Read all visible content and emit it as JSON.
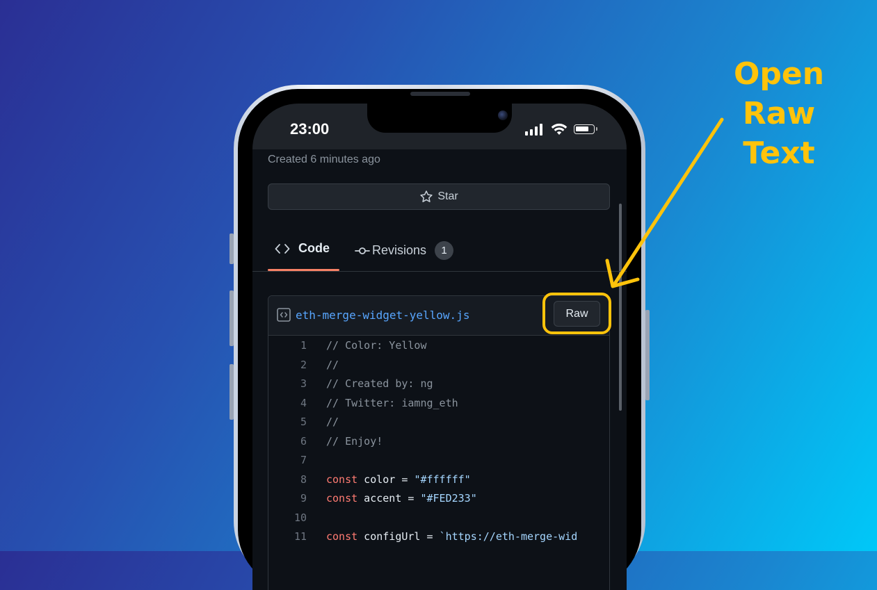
{
  "status_bar": {
    "time": "23:00"
  },
  "gist": {
    "created_text": "Created 6 minutes ago",
    "star_label": "Star"
  },
  "tabs": {
    "code_label": "Code",
    "revisions_label": "Revisions",
    "revisions_count": "1"
  },
  "file": {
    "name": "eth-merge-widget-yellow.js",
    "raw_label": "Raw",
    "lines": [
      {
        "n": "1",
        "tokens": [
          {
            "t": "// Color: Yellow",
            "k": "comment"
          }
        ]
      },
      {
        "n": "2",
        "tokens": [
          {
            "t": "//",
            "k": "comment"
          }
        ]
      },
      {
        "n": "3",
        "tokens": [
          {
            "t": "// Created by: ng",
            "k": "comment"
          }
        ]
      },
      {
        "n": "4",
        "tokens": [
          {
            "t": "// Twitter: iamng_eth",
            "k": "comment"
          }
        ]
      },
      {
        "n": "5",
        "tokens": [
          {
            "t": "//",
            "k": "comment"
          }
        ]
      },
      {
        "n": "6",
        "tokens": [
          {
            "t": "// Enjoy!",
            "k": "comment"
          }
        ]
      },
      {
        "n": "7",
        "tokens": []
      },
      {
        "n": "8",
        "tokens": [
          {
            "t": "const",
            "k": "kw"
          },
          {
            "t": " color = ",
            "k": "plain"
          },
          {
            "t": "\"#ffffff\"",
            "k": "str"
          }
        ]
      },
      {
        "n": "9",
        "tokens": [
          {
            "t": "const",
            "k": "kw"
          },
          {
            "t": " accent = ",
            "k": "plain"
          },
          {
            "t": "\"#FED233\"",
            "k": "str"
          }
        ]
      },
      {
        "n": "10",
        "tokens": []
      },
      {
        "n": "11",
        "tokens": [
          {
            "t": "const",
            "k": "kw"
          },
          {
            "t": " configUrl = ",
            "k": "plain"
          },
          {
            "t": "`https://eth-merge-wid",
            "k": "str"
          }
        ]
      }
    ]
  },
  "annotation": {
    "lines": [
      "Open",
      "Raw",
      "Text"
    ],
    "color": "#FFC30B"
  },
  "colors": {
    "accent_tab": "#F78166",
    "link": "#58A6FF",
    "keyword": "#FF7B72",
    "string": "#A5D6FF"
  }
}
